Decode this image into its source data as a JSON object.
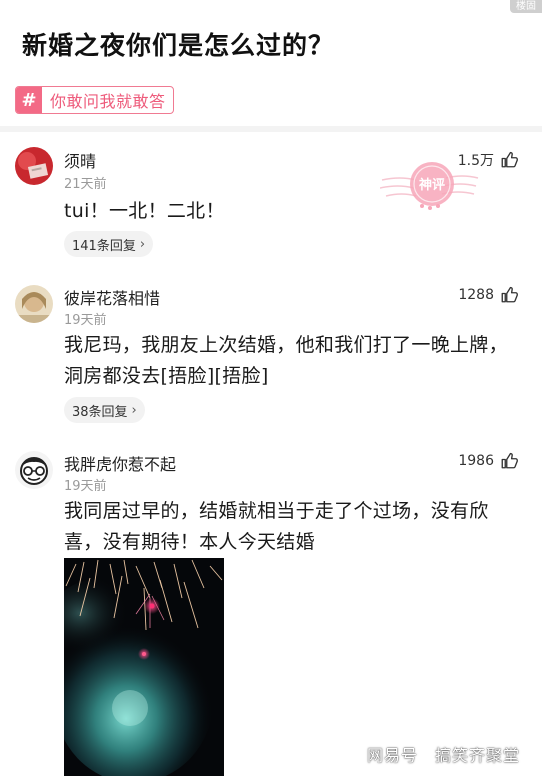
{
  "corner_label": "楼固",
  "question": {
    "title": "新婚之夜你们是怎么过的？",
    "topic_hash": "#",
    "topic": "你敢问我就敢答"
  },
  "comments": [
    {
      "username": "须晴",
      "time": "21天前",
      "likes": "1.5万",
      "text": "tui！一北！二北！",
      "replies": "141条回复",
      "chevron": "›"
    },
    {
      "username": "彼岸花落相惜",
      "time": "19天前",
      "likes": "1288",
      "text": "我尼玛，我朋友上次结婚，他和我们打了一晚上牌，洞房都没去[捂脸][捂脸]",
      "replies": "38条回复",
      "chevron": "›"
    },
    {
      "username": "我胖虎你惹不起",
      "time": "19天前",
      "likes": "1986",
      "text": "我同居过早的，结婚就相当于走了个过场，没有欣喜，没有期待！本人今天结婚"
    }
  ],
  "stamp_text": "神评",
  "watermark": {
    "left": "网易号",
    "right": "搞笑齐聚堂"
  },
  "icons": {
    "like": "thumbs-up-icon",
    "chevron": "chevron-right-icon",
    "topic": "hashtag-icon"
  },
  "colors": {
    "topic_accent": "#f36a86",
    "stamp": "#f4a0b4"
  }
}
